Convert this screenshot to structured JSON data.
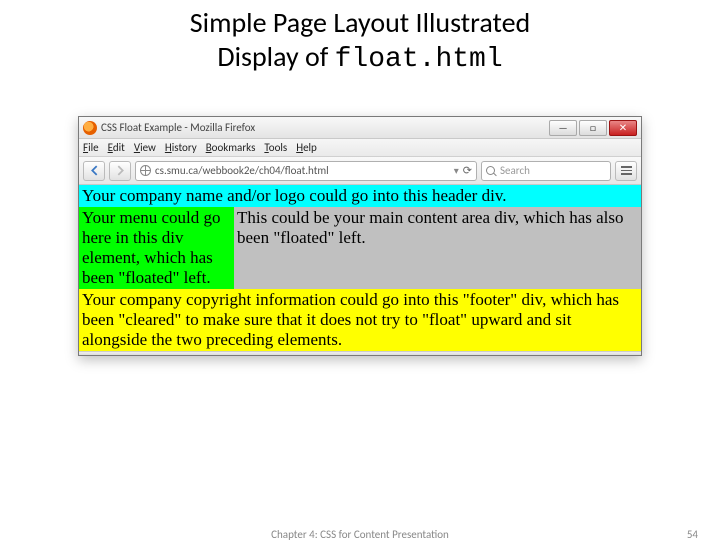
{
  "slide": {
    "title_line1": "Simple Page Layout Illustrated",
    "title_line2_pre": "Display of ",
    "title_line2_code": "float.html",
    "chapter": "Chapter 4: CSS for Content Presentation",
    "page_number": "54"
  },
  "browser": {
    "window_title": "CSS Float Example - Mozilla Firefox",
    "menu": {
      "file": "File",
      "edit": "Edit",
      "view": "View",
      "history": "History",
      "bookmarks": "Bookmarks",
      "tools": "Tools",
      "help": "Help"
    },
    "url": "cs.smu.ca/webbook2e/ch04/float.html",
    "search_placeholder": "Search"
  },
  "page": {
    "header": "Your company name and/or logo could go into this header div.",
    "menu": "Your menu could go here in this div element, which has been \"floated\" left.",
    "content": "This could be your main content area div, which has also been \"floated\" left.",
    "footer": "Your company copyright information could go into this \"footer\" div, which has been \"cleared\" to make sure that it does not try to \"float\" upward and sit alongside the two preceding elements."
  }
}
